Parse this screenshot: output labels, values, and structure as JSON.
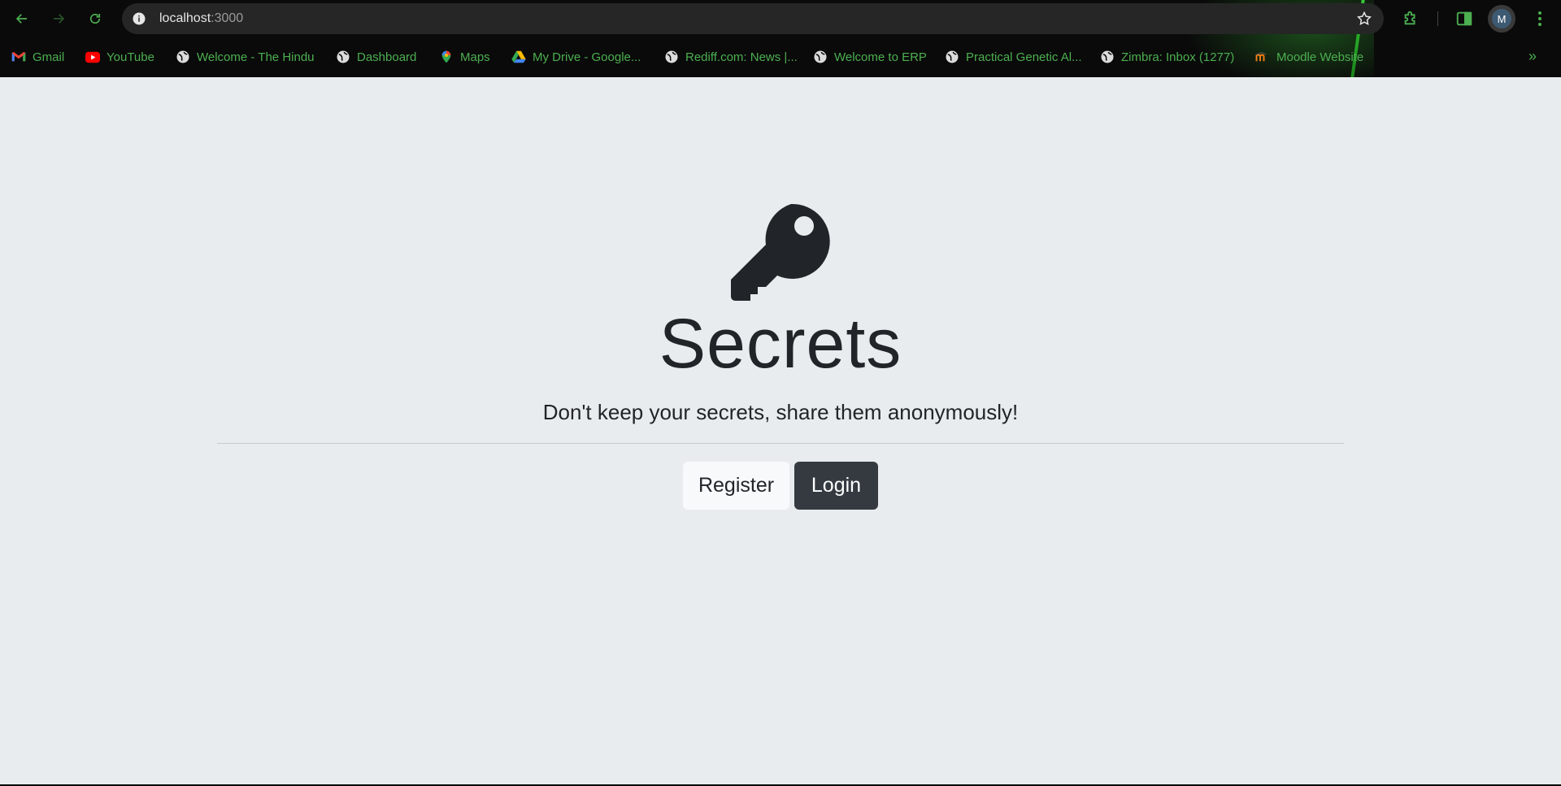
{
  "browser": {
    "url_host": "localhost",
    "url_port": ":3000",
    "profile_initial": "M",
    "bookmarks": [
      {
        "label": "Gmail",
        "icon": "gmail-icon"
      },
      {
        "label": "YouTube",
        "icon": "youtube-icon"
      },
      {
        "label": "Welcome - The Hindu",
        "icon": "globe-icon"
      },
      {
        "label": "Dashboard",
        "icon": "globe-icon"
      },
      {
        "label": "Maps",
        "icon": "maps-icon"
      },
      {
        "label": "My Drive - Google...",
        "icon": "drive-icon"
      },
      {
        "label": "Rediff.com: News |...",
        "icon": "globe-icon"
      },
      {
        "label": "Welcome to ERP",
        "icon": "globe-icon"
      },
      {
        "label": "Practical Genetic Al...",
        "icon": "globe-icon"
      },
      {
        "label": "Zimbra: Inbox (1277)",
        "icon": "globe-icon"
      },
      {
        "label": "Moodle Website",
        "icon": "moodle-icon"
      }
    ],
    "accent_color": "#4caf50"
  },
  "page": {
    "title": "Secrets",
    "lead": "Don't keep your secrets, share them anonymously!",
    "register_label": "Register",
    "login_label": "Login",
    "background": "#e9ecef"
  }
}
